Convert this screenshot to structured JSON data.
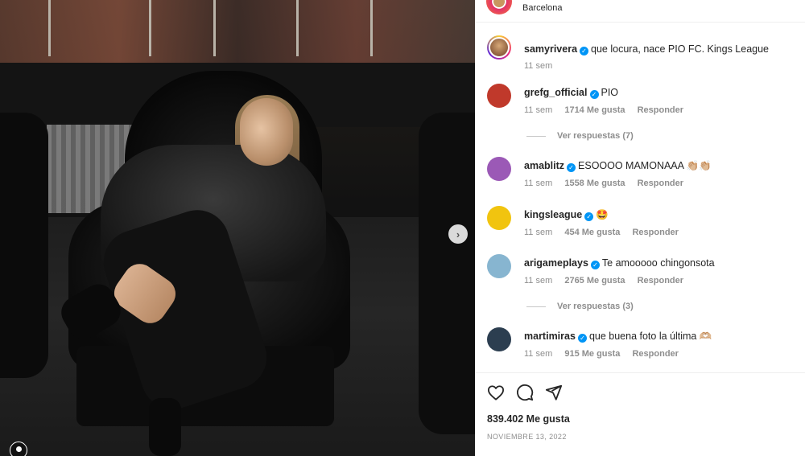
{
  "post": {
    "location": "Barcelona",
    "next_arrow": "›",
    "likes": "839.402 Me gusta",
    "date": "NOVIEMBRE 13, 2022"
  },
  "caption": {
    "user": "samyrivera",
    "text": "que locura, nace PIO FC. Kings League",
    "time": "11 sem"
  },
  "comments": [
    {
      "user": "grefg_official",
      "text": "PIO",
      "time": "11 sem",
      "likes": "1714 Me gusta",
      "reply": "Responder",
      "view_replies": "Ver respuestas (7)",
      "avatar_color": "#c0392b"
    },
    {
      "user": "amablitz",
      "text": "ESOOOO MAMONAAA 👏🏼👏🏼",
      "time": "11 sem",
      "likes": "1558 Me gusta",
      "reply": "Responder",
      "avatar_color": "#9b59b6"
    },
    {
      "user": "kingsleague",
      "text": "🤩",
      "time": "11 sem",
      "likes": "454 Me gusta",
      "reply": "Responder",
      "avatar_color": "#f1c40f"
    },
    {
      "user": "arigameplays",
      "text": "Te amooooo chingonsota",
      "time": "11 sem",
      "likes": "2765 Me gusta",
      "reply": "Responder",
      "view_replies": "Ver respuestas (3)",
      "avatar_color": "#87b5d0"
    },
    {
      "user": "martimiras",
      "text": "que buena foto la última 🫶🏼",
      "time": "11 sem",
      "likes": "915 Me gusta",
      "reply": "Responder",
      "avatar_color": "#2c3e50"
    }
  ],
  "icons": {
    "like": "heart-icon",
    "comment": "comment-icon",
    "share": "share-icon",
    "verified": "verified-badge-icon",
    "tag": "user-tag-icon"
  },
  "colors": {
    "verified": "#0095f6",
    "muted": "#8e8e8e",
    "text": "#262626"
  }
}
